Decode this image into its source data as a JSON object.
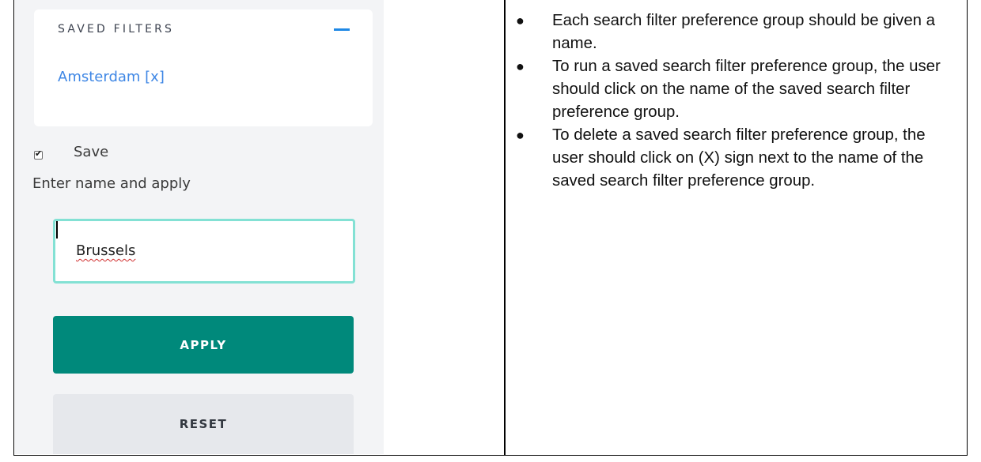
{
  "filters_panel": {
    "saved_filters_title": "SAVED FILTERS",
    "collapse_icon": "minus-icon",
    "saved_items": [
      "Amsterdam [x]"
    ],
    "save_checkbox_checked": true,
    "save_label": "Save",
    "instruction_label": "Enter name and apply",
    "name_input_value": "Brussels",
    "apply_label": "APPLY",
    "reset_label": "RESET",
    "colors": {
      "accent_blue": "#1e88e5",
      "link_blue": "#3f87e5",
      "apply_green": "#00897b",
      "input_focus_border": "#83e1d4",
      "panel_background": "#f3f4f6"
    }
  },
  "notes": {
    "bullets": [
      "Each search filter preference group should be  given a name.",
      "To run a saved search filter preference group,  the user should click on the name of the saved search filter preference group.",
      "To delete a saved search filter preference group,  the user should click on (X) sign next to the name of the saved search filter preference group."
    ]
  }
}
